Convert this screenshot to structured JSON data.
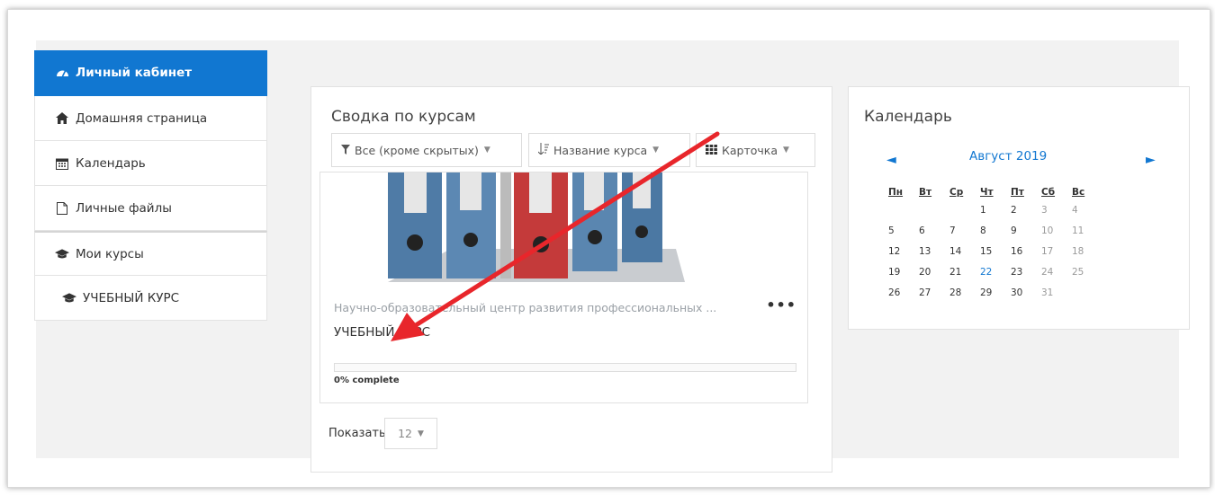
{
  "sidebar": {
    "items": [
      {
        "label": "Личный кабинет",
        "icon": "dashboard-icon",
        "active": true
      },
      {
        "label": "Домашняя страница",
        "icon": "home-icon"
      },
      {
        "label": "Календарь",
        "icon": "calendar-icon"
      },
      {
        "label": "Личные файлы",
        "icon": "file-icon"
      },
      {
        "label": "Мои курсы",
        "icon": "graduation-cap-icon"
      },
      {
        "label": "УЧЕБНЫЙ КУРС",
        "icon": "graduation-cap-icon"
      }
    ]
  },
  "overview": {
    "title": "Сводка по курсам",
    "filter": {
      "label": "Все (кроме скрытых)",
      "icon": "filter-icon"
    },
    "sort": {
      "label": "Название курса",
      "icon": "sort-icon"
    },
    "view": {
      "label": "Карточка",
      "icon": "grid-icon"
    },
    "course": {
      "category": "Научно-образовательный центр развития профессиональных ...",
      "name": "УЧЕБНЫЙ КУРС",
      "menu": "•••",
      "progress_percent": 0,
      "progress_text": "0% complete"
    },
    "show_label": "Показать",
    "show_value": "12"
  },
  "calendar": {
    "title": "Календарь",
    "month": "Август 2019",
    "prev": "◄",
    "next": "►",
    "weekdays": [
      "Пн",
      "Вт",
      "Ср",
      "Чт",
      "Пт",
      "Сб",
      "Вс"
    ],
    "weeks": [
      [
        "",
        "",
        "",
        "1",
        "2",
        "3",
        "4"
      ],
      [
        "5",
        "6",
        "7",
        "8",
        "9",
        "10",
        "11"
      ],
      [
        "12",
        "13",
        "14",
        "15",
        "16",
        "17",
        "18"
      ],
      [
        "19",
        "20",
        "21",
        "22",
        "23",
        "24",
        "25"
      ],
      [
        "26",
        "27",
        "28",
        "29",
        "30",
        "31",
        ""
      ]
    ],
    "today": "22"
  },
  "colors": {
    "accent": "#1177d1",
    "annotation_arrow": "#e8262b"
  }
}
